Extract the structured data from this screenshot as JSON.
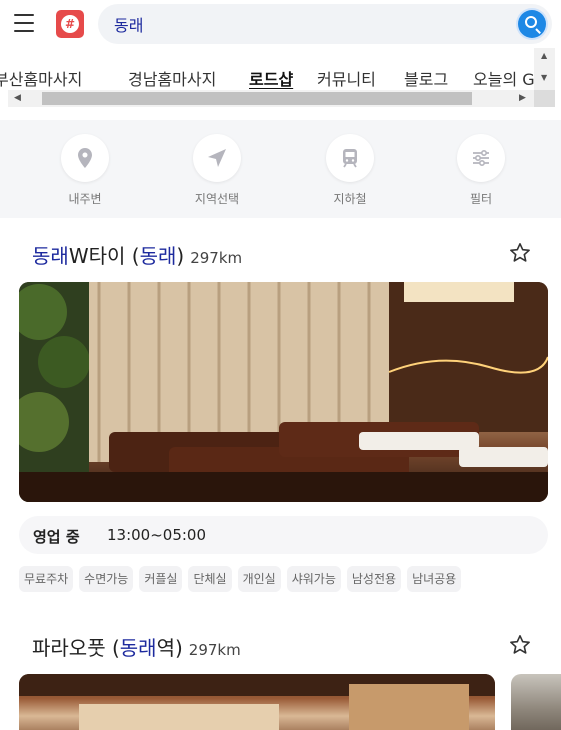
{
  "header": {
    "search_value": "동래",
    "logo_text": "#"
  },
  "tabs": [
    {
      "label": "부산홈마사지",
      "active": false
    },
    {
      "label": "경남홈마사지",
      "active": false
    },
    {
      "label": "로드샵",
      "active": true
    },
    {
      "label": "커뮤니티",
      "active": false
    },
    {
      "label": "블로그",
      "active": false
    },
    {
      "label": "오늘의 G",
      "active": false
    }
  ],
  "quick_nav": [
    {
      "label": "내주변",
      "icon": "location-pin-icon"
    },
    {
      "label": "지역선택",
      "icon": "navigation-arrow-icon"
    },
    {
      "label": "지하철",
      "icon": "subway-icon"
    },
    {
      "label": "필터",
      "icon": "sliders-icon"
    }
  ],
  "listings": [
    {
      "name_hl1": "동래",
      "name_mid": "W타이 (",
      "name_hl2": "동래",
      "name_end": ")",
      "distance": "297km",
      "hours_label": "영업 중",
      "hours": "13:00~05:00",
      "tags": [
        "무료주차",
        "수면가능",
        "커플실",
        "단체실",
        "개인실",
        "샤워가능",
        "남성전용",
        "남녀공용"
      ]
    },
    {
      "name_pre": "파라오풋 (",
      "name_hl": "동래",
      "name_end": "역)",
      "distance": "297km"
    }
  ],
  "colors": {
    "highlight": "#1d2a9e",
    "logo": "#e64a4a",
    "search_button": "#1e88e5"
  }
}
